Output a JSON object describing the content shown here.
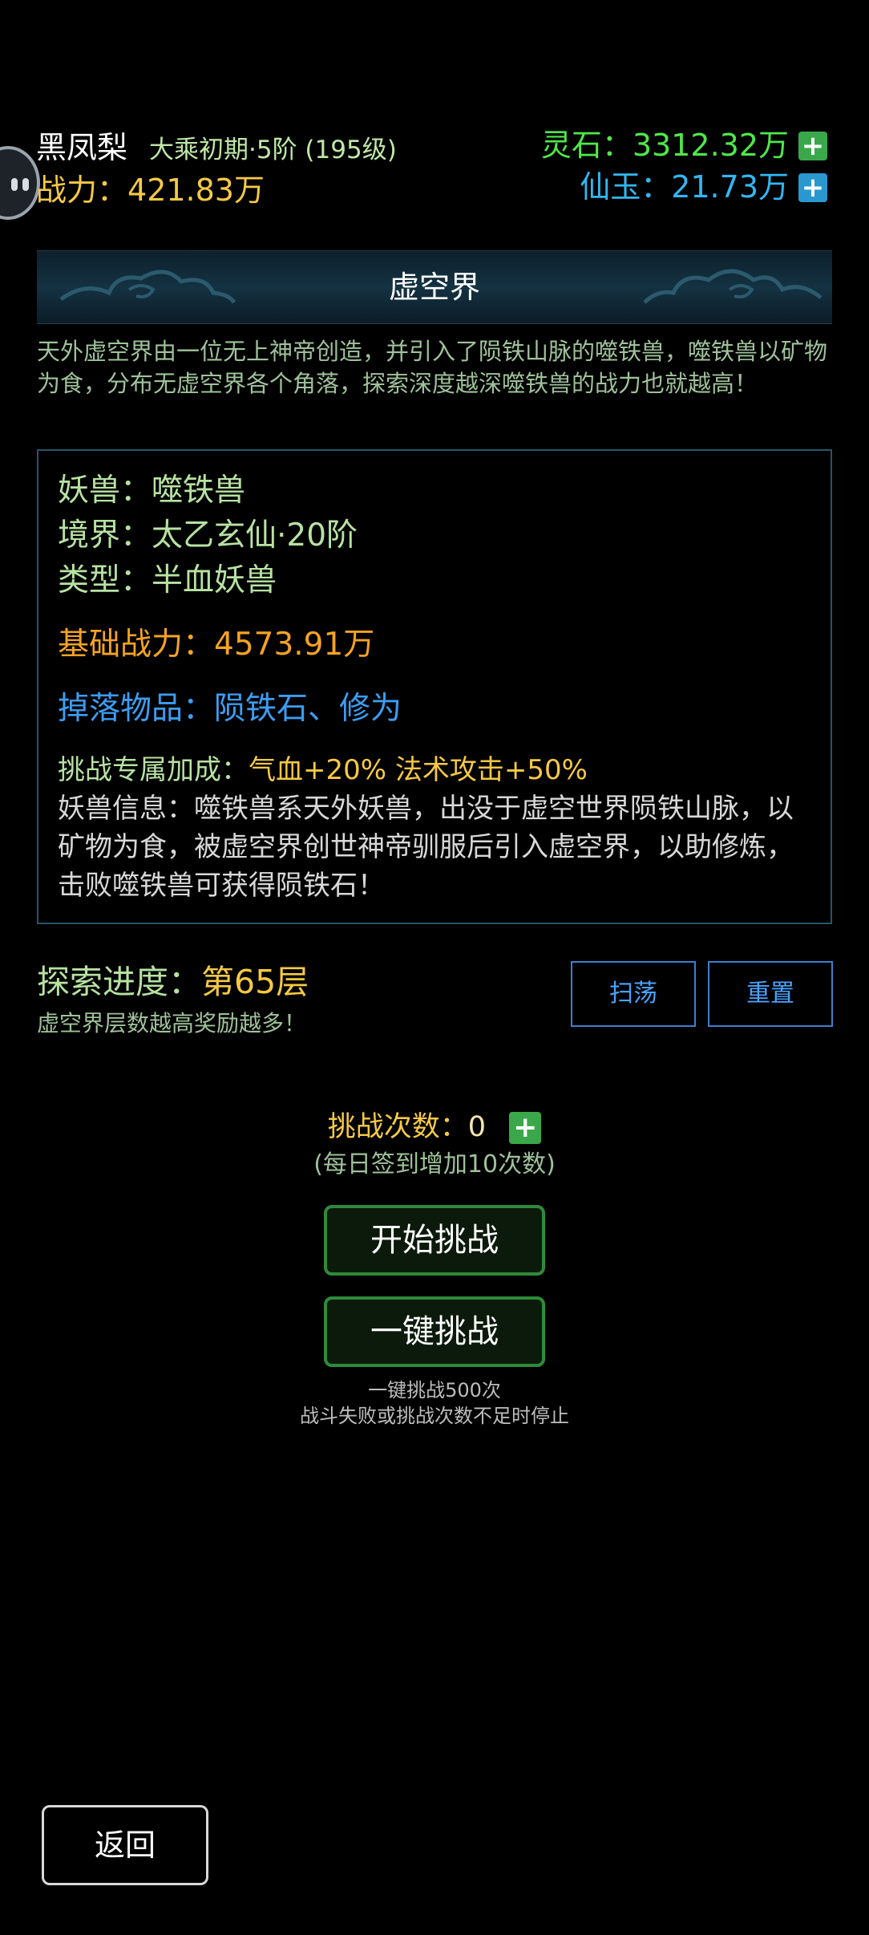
{
  "player": {
    "name": "黑凤梨",
    "realm": "大乘初期·5阶 (195级)",
    "power_label": "战力：",
    "power_value": "421.83万"
  },
  "resources": {
    "lingshi_label": "灵石：",
    "lingshi_value": "3312.32万",
    "xianyu_label": "仙玉：",
    "xianyu_value": "21.73万",
    "plus": "+"
  },
  "area": {
    "title": "虚空界",
    "description": "天外虚空界由一位无上神帝创造，并引入了陨铁山脉的噬铁兽，噬铁兽以矿物为食，分布无虚空界各个角落，探索深度越深噬铁兽的战力也就越高！"
  },
  "monster": {
    "name_label": "妖兽：",
    "name": "噬铁兽",
    "realm_label": "境界：",
    "realm": "太乙玄仙·20阶",
    "type_label": "类型：",
    "type": "半血妖兽",
    "base_power_label": "基础战力：",
    "base_power": "4573.91万",
    "drops_label": "掉落物品：",
    "drops": "陨铁石、修为",
    "bonus_label": "挑战专属加成：",
    "bonus": "气血+20% 法术攻击+50%",
    "info_label": "妖兽信息：",
    "info": "噬铁兽系天外妖兽，出没于虚空世界陨铁山脉，以矿物为食，被虚空界创世神帝驯服后引入虚空界，以助修炼，击败噬铁兽可获得陨铁石！"
  },
  "explore": {
    "label": "探索进度：",
    "value": "第65层",
    "sub": "虚空界层数越高奖励越多！",
    "sweep_label": "扫荡",
    "reset_label": "重置"
  },
  "challenge": {
    "count_label": "挑战次数：",
    "count": "0",
    "hint": "(每日签到增加10次数)",
    "start_label": "开始挑战",
    "oneclick_label": "一键挑战",
    "oneclick_note1": "一键挑战500次",
    "oneclick_note2": "战斗失败或挑战次数不足时停止"
  },
  "footer": {
    "back_label": "返回"
  },
  "colors": {
    "lingshi": "#4fe84a",
    "xianyu": "#33b7f2",
    "power": "#f6c945",
    "base_power": "#f5a322",
    "drops": "#3c9df2",
    "accent_green": "#2e8a3a"
  }
}
